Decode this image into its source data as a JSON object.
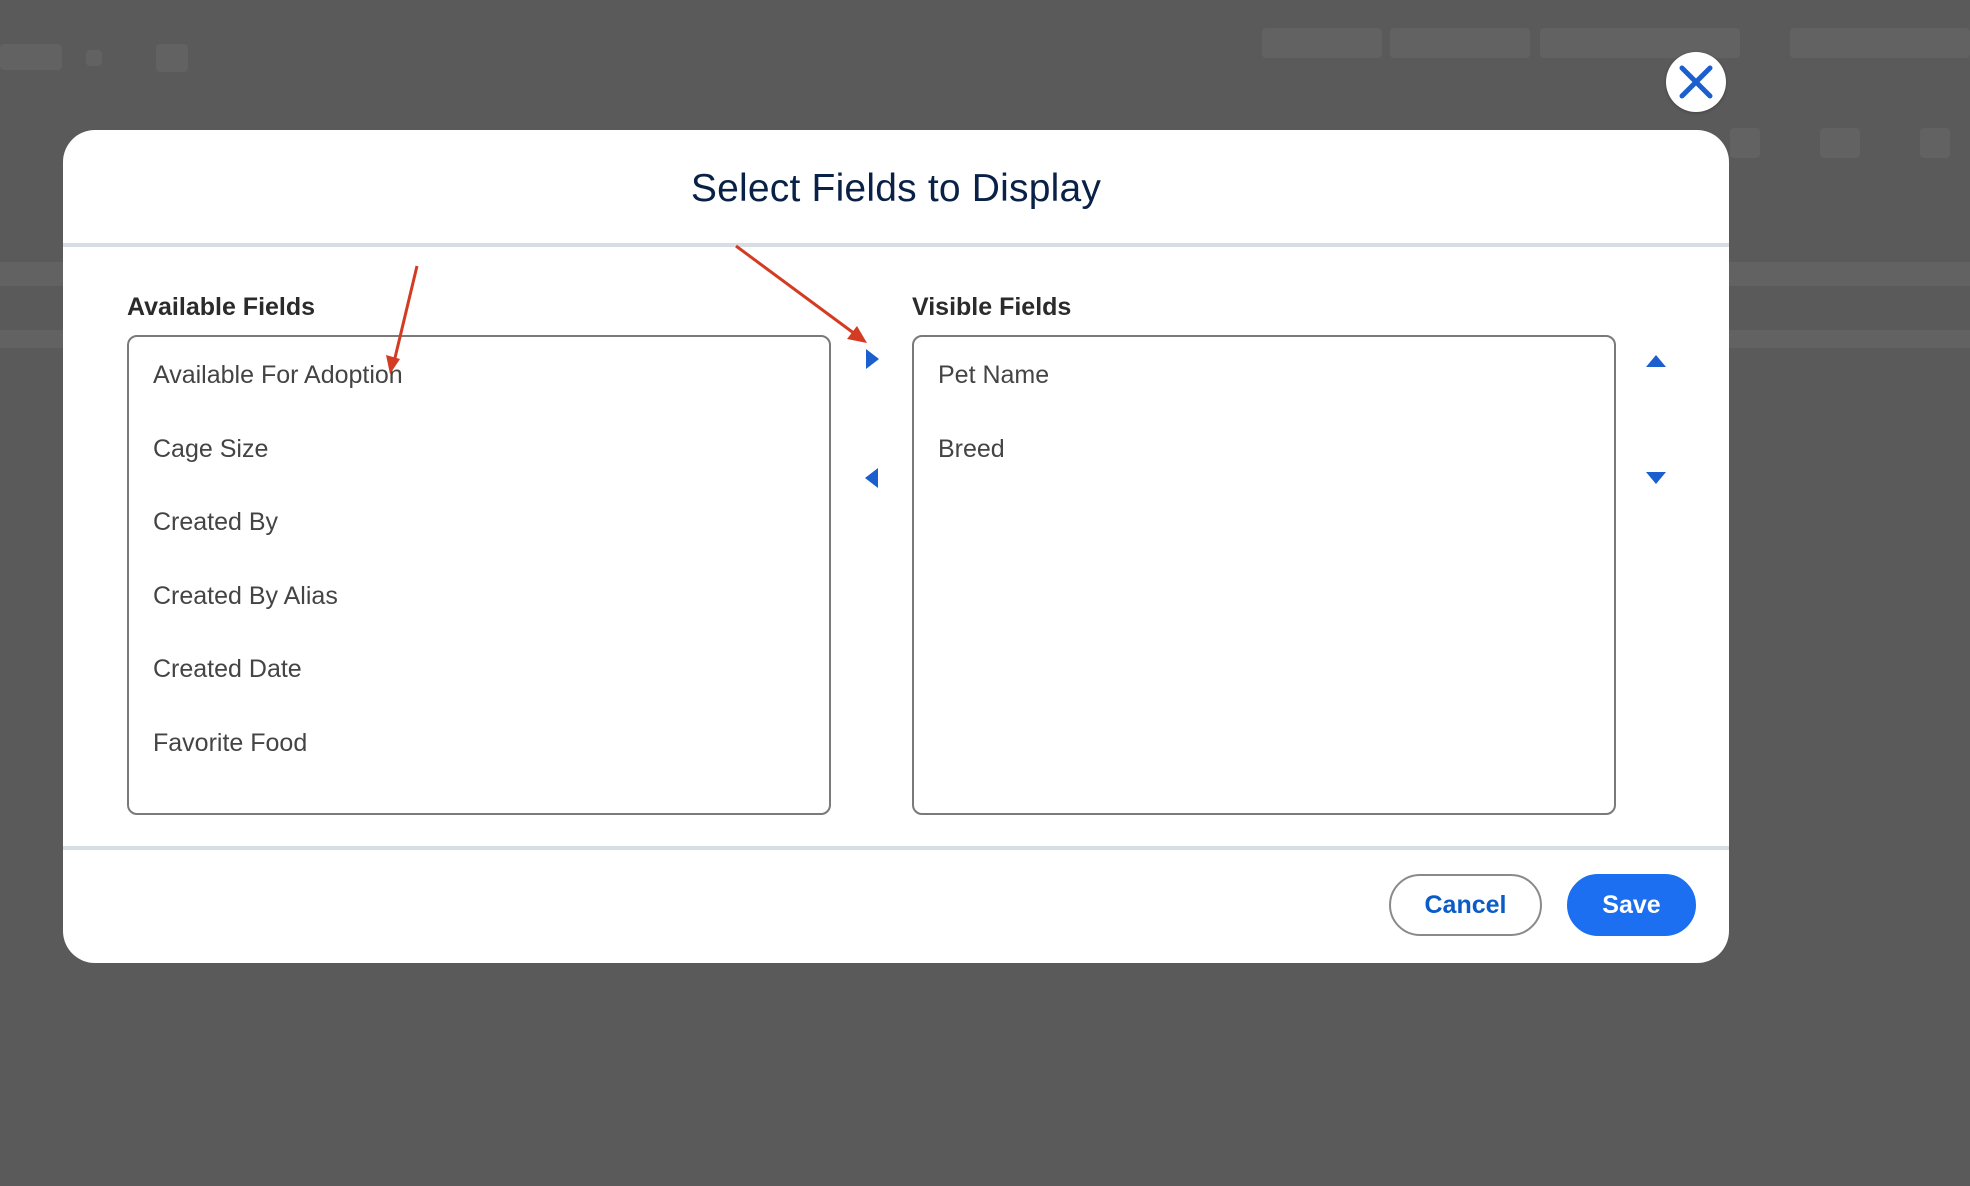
{
  "modal": {
    "title": "Select Fields to Display"
  },
  "available": {
    "label": "Available Fields",
    "items": [
      "Available For Adoption",
      "Cage Size",
      "Created By",
      "Created By Alias",
      "Created Date",
      "Favorite Food"
    ]
  },
  "visible": {
    "label": "Visible Fields",
    "items": [
      "Pet Name",
      "Breed"
    ]
  },
  "footer": {
    "cancel_label": "Cancel",
    "save_label": "Save"
  },
  "icons": {
    "close": "close-icon",
    "move_right": "chevron-right-icon",
    "move_left": "chevron-left-icon",
    "move_up": "chevron-up-icon",
    "move_down": "chevron-down-icon"
  },
  "colors": {
    "accent": "#1b6ff0",
    "title": "#0a2147",
    "annotation_arrow": "#d43b23",
    "overlay": "#5a5a5a"
  }
}
